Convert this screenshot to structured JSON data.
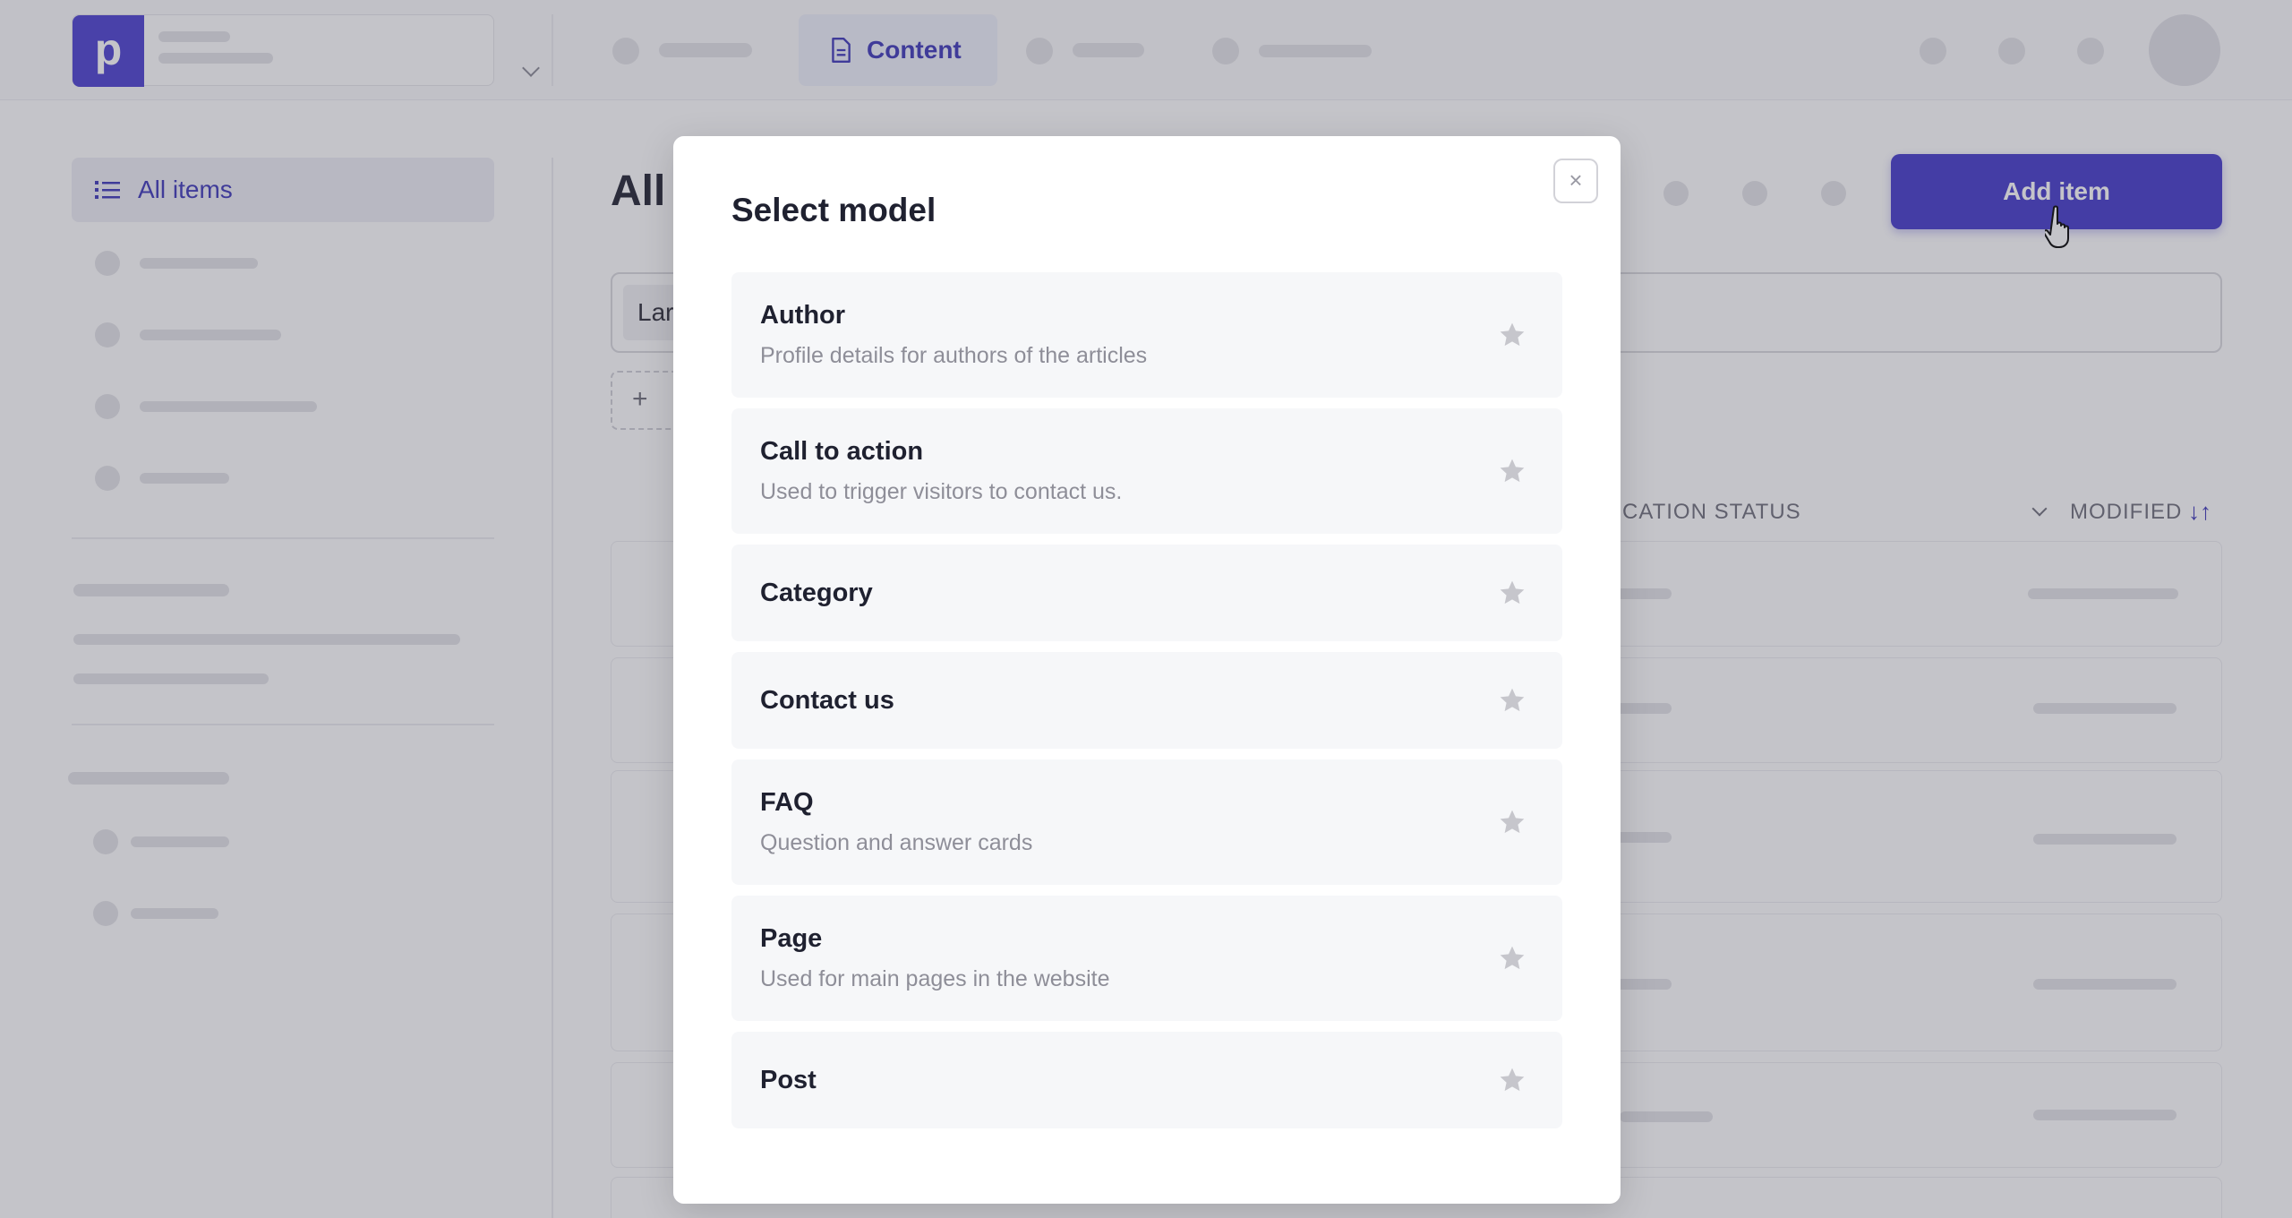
{
  "header": {
    "logo_letter": "p",
    "active_tab": "Content"
  },
  "sidebar": {
    "active_item": "All items"
  },
  "main": {
    "title": "All",
    "add_button": "Add item",
    "filter_chip": "Lar",
    "columns": {
      "status": "LICATION STATUS",
      "modified": "MODIFIED",
      "sort": "↓↑"
    }
  },
  "modal": {
    "title": "Select model",
    "close_label": "×",
    "models": [
      {
        "name": "Author",
        "description": "Profile details for authors of the articles"
      },
      {
        "name": "Call to action",
        "description": "Used to trigger visitors to contact us."
      },
      {
        "name": "Category",
        "description": ""
      },
      {
        "name": "Contact us",
        "description": ""
      },
      {
        "name": "FAQ",
        "description": "Question and answer cards"
      },
      {
        "name": "Page",
        "description": "Used for main pages in the website"
      },
      {
        "name": "Post",
        "description": ""
      }
    ]
  },
  "colors": {
    "accent": "#4338ca",
    "overlay": "#464856"
  }
}
